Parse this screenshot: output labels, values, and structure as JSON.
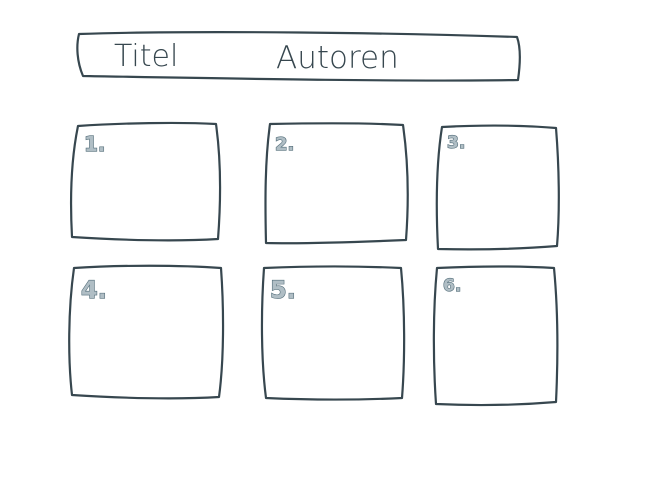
{
  "header": {
    "title_label": "Titel",
    "authors_label": "Autoren"
  },
  "panels": [
    {
      "number": "1."
    },
    {
      "number": "2."
    },
    {
      "number": "3."
    },
    {
      "number": "4."
    },
    {
      "number": "5."
    },
    {
      "number": "6."
    }
  ],
  "colors": {
    "ink": "#37474f",
    "number_fill": "#b0bec5",
    "background": "#ffffff"
  }
}
